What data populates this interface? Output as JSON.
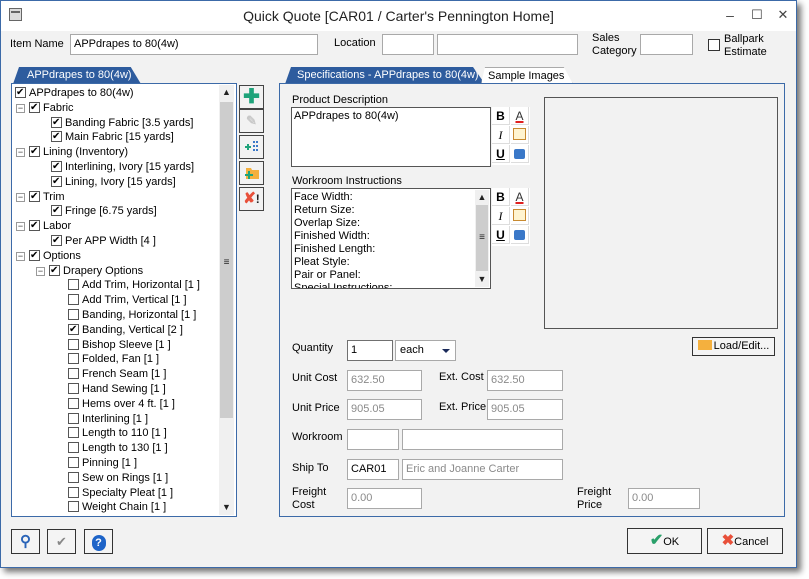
{
  "window": {
    "title": "Quick Quote [CAR01 / Carter's Pennington Home]",
    "minimize": "–",
    "maximize": "☐",
    "close": "✕"
  },
  "header": {
    "item_name_label": "Item Name",
    "item_name_value": "APPdrapes to  80(4w)",
    "location_label": "Location",
    "location_code": "",
    "location_name": "",
    "sales_category_label": "Sales\nCategory",
    "sales_category_line1": "Sales",
    "sales_category_line2": "Category",
    "sales_category_value": "",
    "ballpark_line1": "Ballpark",
    "ballpark_line2": "Estimate",
    "ballpark_checked": false
  },
  "left_panel": {
    "tab_label": "APPdrapes to  80(4w)",
    "tree": [
      {
        "label": "APPdrapes to  80(4w)",
        "level": 0,
        "checked": true,
        "expander": false
      },
      {
        "label": "Fabric",
        "level": 1,
        "checked": true,
        "expander": true
      },
      {
        "label": "Banding Fabric [3.5 yards]",
        "level": 2,
        "checked": true,
        "expander": false
      },
      {
        "label": "Main Fabric [15 yards]",
        "level": 2,
        "checked": true,
        "expander": false
      },
      {
        "label": "Lining (Inventory)",
        "level": 1,
        "checked": true,
        "expander": true
      },
      {
        "label": "Interlining, Ivory [15 yards]",
        "level": 2,
        "checked": true,
        "expander": false
      },
      {
        "label": "Lining, Ivory [15 yards]",
        "level": 2,
        "checked": true,
        "expander": false
      },
      {
        "label": "Trim",
        "level": 1,
        "checked": true,
        "expander": true
      },
      {
        "label": "Fringe [6.75 yards]",
        "level": 2,
        "checked": true,
        "expander": false
      },
      {
        "label": "Labor",
        "level": 1,
        "checked": true,
        "expander": true
      },
      {
        "label": "Per APP Width [4 ]",
        "level": 2,
        "checked": true,
        "expander": false
      },
      {
        "label": "Options",
        "level": 1,
        "checked": true,
        "expander": true
      },
      {
        "label": "Drapery Options",
        "level": 2,
        "checked": true,
        "expander": true
      },
      {
        "label": "Add Trim, Horizontal [1 ]",
        "level": 3,
        "checked": false,
        "expander": false
      },
      {
        "label": "Add Trim, Vertical [1 ]",
        "level": 3,
        "checked": false,
        "expander": false
      },
      {
        "label": "Banding, Horizontal [1 ]",
        "level": 3,
        "checked": false,
        "expander": false
      },
      {
        "label": "Banding, Vertical [2 ]",
        "level": 3,
        "checked": true,
        "expander": false
      },
      {
        "label": "Bishop Sleeve [1 ]",
        "level": 3,
        "checked": false,
        "expander": false
      },
      {
        "label": "Folded, Fan [1 ]",
        "level": 3,
        "checked": false,
        "expander": false
      },
      {
        "label": "French Seam [1 ]",
        "level": 3,
        "checked": false,
        "expander": false
      },
      {
        "label": "Hand Sewing [1 ]",
        "level": 3,
        "checked": false,
        "expander": false
      },
      {
        "label": "Hems over 4 ft. [1 ]",
        "level": 3,
        "checked": false,
        "expander": false
      },
      {
        "label": "Interlining [1 ]",
        "level": 3,
        "checked": false,
        "expander": false
      },
      {
        "label": "Length to 110 [1 ]",
        "level": 3,
        "checked": false,
        "expander": false
      },
      {
        "label": "Length to 130 [1 ]",
        "level": 3,
        "checked": false,
        "expander": false
      },
      {
        "label": "Pinning [1 ]",
        "level": 3,
        "checked": false,
        "expander": false
      },
      {
        "label": "Sew on Rings [1 ]",
        "level": 3,
        "checked": false,
        "expander": false
      },
      {
        "label": "Specialty Pleat [1 ]",
        "level": 3,
        "checked": false,
        "expander": false
      },
      {
        "label": "Weight Chain [1 ]",
        "level": 3,
        "checked": false,
        "expander": false
      }
    ]
  },
  "toolbar": {
    "add_icon": "plus-icon",
    "edit_icon": "pencil-icon",
    "add_child_icon": "add-child-icon",
    "add_folder_icon": "add-folder-icon",
    "delete_icon": "delete-icon"
  },
  "right_panel": {
    "tabs": [
      {
        "label": "Specifications - APPdrapes to  80(4w)",
        "active": true
      },
      {
        "label": "Sample Images",
        "active": false
      }
    ],
    "product_description_label": "Product Description",
    "product_description_value": "APPdrapes to  80(4w)",
    "workroom_instructions_label": "Workroom Instructions",
    "workroom_instructions_lines": [
      "Face Width:",
      "Return Size:",
      "Overlap Size:",
      "Finished Width:",
      "Finished Length:",
      "Pleat Style:",
      "Pair or Panel:",
      "Special Instructions:"
    ],
    "format_buttons": {
      "bold": "B",
      "italic": "I",
      "underline": "U",
      "font_color": "A"
    },
    "load_edit_label": "Load/Edit...",
    "quantity_label": "Quantity",
    "quantity_value": "1",
    "unit_selected": "each",
    "unit_cost_label": "Unit Cost",
    "unit_cost_value": "632.50",
    "ext_cost_label": "Ext. Cost",
    "ext_cost_value": "632.50",
    "unit_price_label": "Unit Price",
    "unit_price_value": "905.05",
    "ext_price_label": "Ext. Price",
    "ext_price_value": "905.05",
    "workroom_label": "Workroom",
    "workroom_code": "",
    "workroom_name": "",
    "ship_to_label": "Ship To",
    "ship_to_code": "CAR01",
    "ship_to_name": "Eric and Joanne Carter",
    "freight_cost_line1": "Freight",
    "freight_cost_line2": "Cost",
    "freight_cost_value": "0.00",
    "freight_price_line1": "Freight",
    "freight_price_line2": "Price",
    "freight_price_value": "0.00"
  },
  "footer": {
    "ok_label": "OK",
    "cancel_label": "Cancel"
  },
  "colors": {
    "accent": "#2e5c9e",
    "ok_check": "#2aa06a",
    "cancel_x": "#e8503a",
    "add_green": "#1fa37a",
    "folder": "#f4b03e"
  }
}
